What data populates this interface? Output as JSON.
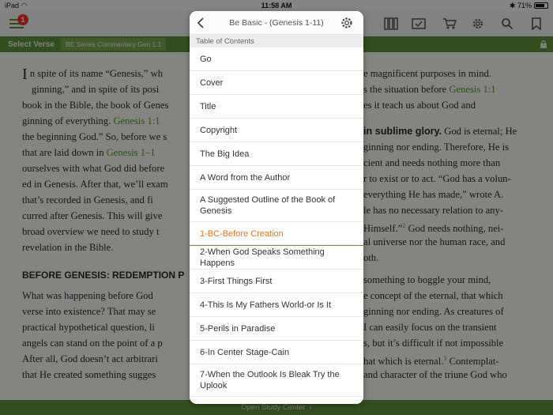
{
  "status": {
    "device": "iPad",
    "time": "11:58 AM",
    "battery": "71%"
  },
  "toolbar": {
    "notification_count": "1"
  },
  "versebar": {
    "select_label": "Select Verse",
    "resource_tag": "BE Series Commentary Gen 1:1"
  },
  "popover": {
    "title": "Be Basic - (Genesis 1-11)",
    "section": "Table of Contents",
    "items": [
      {
        "label": "Go"
      },
      {
        "label": "Cover"
      },
      {
        "label": "Title"
      },
      {
        "label": "Copyright"
      },
      {
        "label": "The Big Idea"
      },
      {
        "label": "A Word from the Author"
      },
      {
        "label": "A Suggested Outline of the Book of Genesis"
      },
      {
        "label": "1-BC-Before Creation",
        "active": true
      },
      {
        "label": "2-When God Speaks Something Happens"
      },
      {
        "label": "3-First Things First"
      },
      {
        "label": "4-This Is My Fathers World-or Is It"
      },
      {
        "label": "5-Perils in Paradise"
      },
      {
        "label": "6-In Center Stage-Cain"
      },
      {
        "label": "7-When the Outlook Is Bleak Try the Uplook"
      }
    ]
  },
  "bottom_bar": {
    "label": "Open Study Center"
  },
  "left_text": {
    "l1a": "n spite of its name “Genesis,” wh",
    "l2": "ginning,” and in spite of its posi",
    "l3": "book in the Bible, the book of Genes",
    "l4a": "ginning of everything. ",
    "l4g": "Genesis 1:1",
    "l5": "the beginning God.” So, before we s",
    "l6a": "that are laid down in ",
    "l6g": "Genesis 1–1",
    "l7": "ourselves with what God did before",
    "l8": "ed in Genesis. After that, we’ll exam",
    "l9": "that’s recorded in Genesis, and fi",
    "l10": "curred after Genesis. This will give",
    "l11": "broad overview we need to study t",
    "l12": "revelation in the Bible.",
    "heading": "BEFORE GENESIS: REDEMPTION P",
    "p2l1": "What was happening before God",
    "p2l2": "verse into existence? That may se",
    "p2l3": "practical hypothetical question, li",
    "p2l4": "angels can stand on the point of a p",
    "p2l5": "After all, God doesn’t act arbitrari",
    "p2l6": "that He created something sugges"
  },
  "right_text": {
    "r1": "e magnificent purposes in mind.",
    "r2a": "s the situation before ",
    "r2g": "Genesis 1:1",
    "r3": "es it teach us about God and",
    "r5b": "in sublime glory.",
    "r5": " God is eternal; He",
    "r6": "ginning nor ending. Therefore, He is",
    "r7": "cient and needs nothing more than",
    "r8": "r to exist or to act. “God has a volun-",
    "r9": "everything He has made,” wrote A.",
    "r10": "le has no necessary relation to any-",
    "r11a": "Himself.”",
    "r11s": "2",
    "r11b": " God needs nothing, nei-",
    "r12": "al universe nor the human race, and",
    "r13": "oth.",
    "p2r1": "something to boggle your mind,",
    "p2r2": "e concept of the eternal, that which",
    "p2r3": "ginning nor ending. As creatures of",
    "p2r4": "I can easily focus on the transient",
    "p2r5": "s, but it’s difficult if not impossible",
    "p2r6a": "hat which is eternal.",
    "p2r6s": "3",
    "p2r6b": " Contemplat-",
    "p2r7": "and character of the triune God who"
  }
}
